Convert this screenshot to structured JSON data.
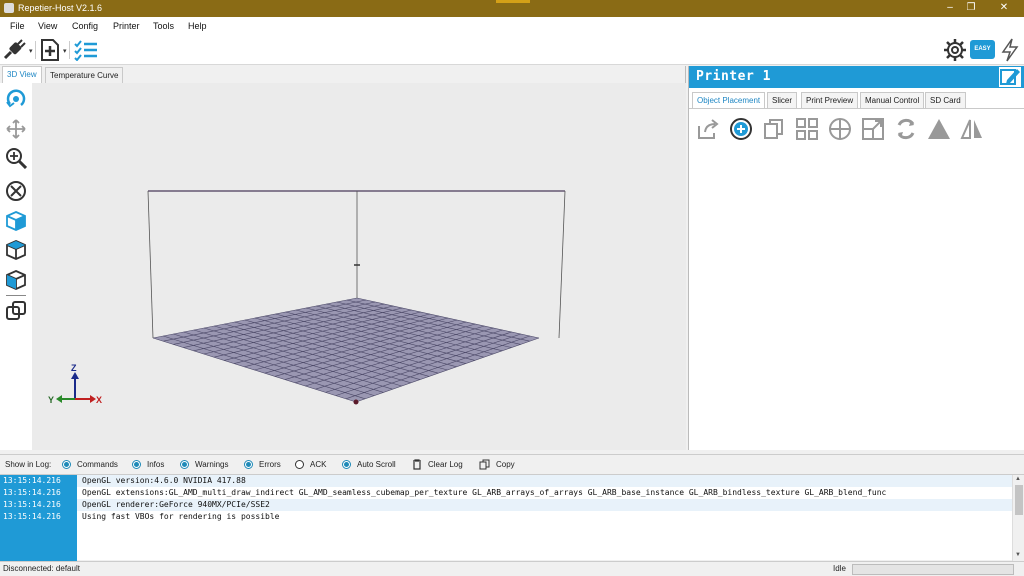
{
  "window": {
    "title": "Repetier-Host V2.1.6",
    "controls": [
      "minimize-icon",
      "restore-icon",
      "close-icon"
    ]
  },
  "menu": [
    "File",
    "View",
    "Config",
    "Printer",
    "Tools",
    "Help"
  ],
  "toolbar": {
    "left_icons": [
      "connect-icon",
      "add-object-icon",
      "object-list-icon"
    ],
    "right_icons": [
      "gear-icon",
      "easy-mode-icon",
      "emergency-stop-icon"
    ],
    "easy_label": "EASY"
  },
  "view_tabs": [
    "3D View",
    "Temperature Curve"
  ],
  "active_view_tab": "3D View",
  "view_tools": [
    "rotate-icon",
    "move-icon",
    "zoom-icon",
    "fit-view-icon",
    "front-view-icon",
    "top-view-icon",
    "side-view-icon",
    "parallel-view-icon"
  ],
  "axes": {
    "z": "Z",
    "y": "Y",
    "x": "X"
  },
  "printer": {
    "name": "Printer 1",
    "tabs": [
      "Object Placement",
      "Slicer",
      "Print Preview",
      "Manual Control",
      "SD Card"
    ],
    "active_tab": "Object Placement",
    "object_tools": [
      "export-icon",
      "add-icon",
      "copy-icon",
      "autoposition-icon",
      "center-icon",
      "scale-icon",
      "rotate-object-icon",
      "cut-icon",
      "mirror-icon"
    ]
  },
  "log_bar": {
    "show_in_log": "Show in Log:",
    "filters": [
      {
        "label": "Commands",
        "checked": true
      },
      {
        "label": "Infos",
        "checked": true
      },
      {
        "label": "Warnings",
        "checked": true
      },
      {
        "label": "Errors",
        "checked": true
      },
      {
        "label": "ACK",
        "checked": false
      },
      {
        "label": "Auto Scroll",
        "checked": true
      }
    ],
    "clear_log": "Clear Log",
    "copy": "Copy"
  },
  "log": [
    {
      "time": "13:15:14.216",
      "message": "OpenGL version:4.6.0 NVIDIA 417.88"
    },
    {
      "time": "13:15:14.216",
      "message": "OpenGL extensions:GL_AMD_multi_draw_indirect GL_AMD_seamless_cubemap_per_texture GL_ARB_arrays_of_arrays GL_ARB_base_instance GL_ARB_bindless_texture GL_ARB_blend_func"
    },
    {
      "time": "13:15:14.216",
      "message": "OpenGL renderer:GeForce 940MX/PCIe/SSE2"
    },
    {
      "time": "13:15:14.216",
      "message": "Using fast VBOs for rendering is possible"
    }
  ],
  "status": {
    "connection": "Disconnected: default",
    "state": "Idle",
    "progress": 0
  },
  "colors": {
    "titlebar": "#8a6b15",
    "accent": "#1f9ad6",
    "bed_grid": "#4a4766",
    "bed_fill": "#9a97b2"
  }
}
